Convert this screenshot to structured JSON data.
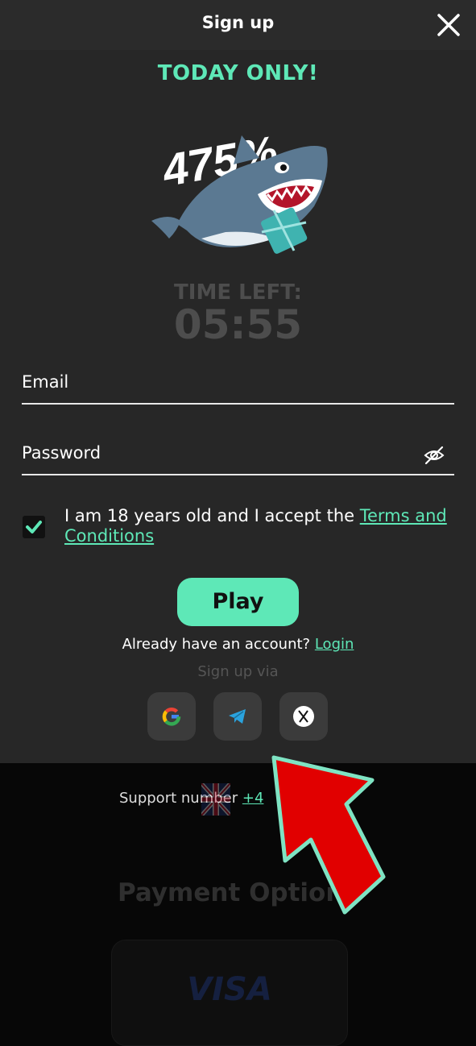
{
  "header": {
    "title": "Sign up"
  },
  "promo": {
    "headline": "TODAY ONLY!",
    "percent": "475%"
  },
  "timer": {
    "label": "TIME LEFT:",
    "value": "05:55"
  },
  "form": {
    "email_label": "Email",
    "password_label": "Password",
    "consent_text": "I am 18 years old and I accept the ",
    "terms_link": "Terms and Conditions",
    "consent_checked": true
  },
  "actions": {
    "play_label": "Play",
    "already_text": "Already have an account? ",
    "login_link": "Login",
    "signup_via": "Sign up via",
    "social": [
      "google-icon",
      "telegram-icon",
      "x-icon"
    ]
  },
  "footer": {
    "support_text": "Support number ",
    "support_link": "+4",
    "payment_title": "Payment Options",
    "payment_card": "VISA"
  },
  "colors": {
    "accent": "#5ee8b7",
    "header_bg": "#2b2b2b",
    "modal_bg": "#272727",
    "arrow": "#e10000"
  }
}
